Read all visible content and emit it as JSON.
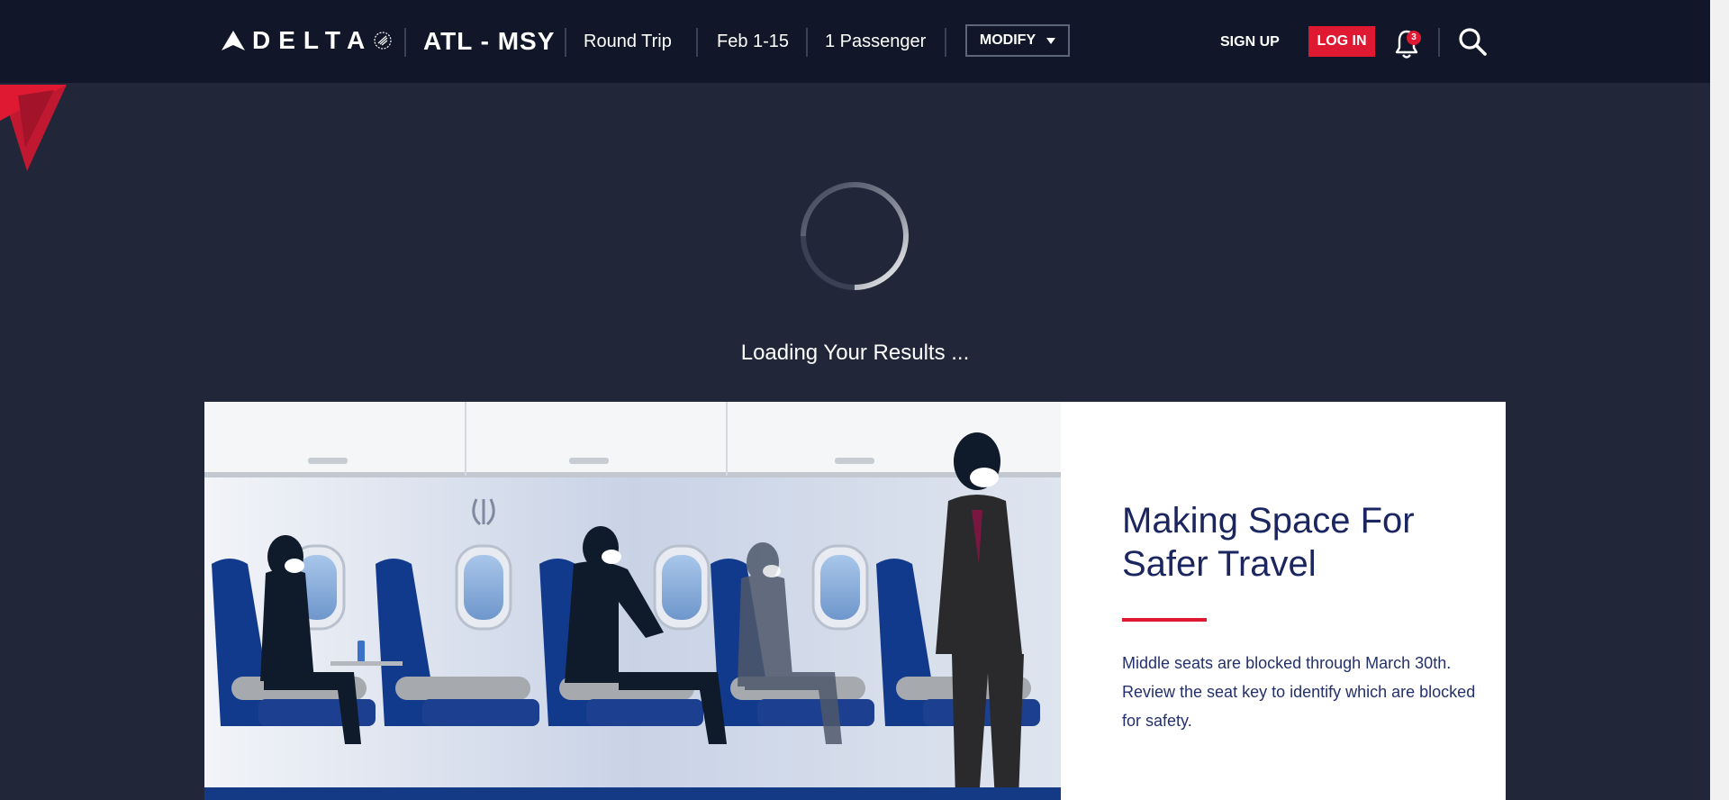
{
  "header": {
    "brand": "DELTA",
    "route": "ATL - MSY",
    "trip_type": "Round Trip",
    "dates": "Feb 1-15",
    "passengers": "1 Passenger",
    "modify_label": "MODIFY",
    "signup_label": "SIGN UP",
    "login_label": "LOG IN",
    "notification_count": "3"
  },
  "loading": {
    "message": "Loading Your Results ..."
  },
  "promo": {
    "title": "Making Space For Safer Travel",
    "body": "Middle seats are blocked through March 30th. Review the seat key to identify which are blocked for safety."
  },
  "icons": {
    "logo": "delta-widget-icon",
    "bell": "bell-icon",
    "search": "search-icon",
    "caret": "chevron-down-icon"
  },
  "colors": {
    "header_bg": "#111728",
    "page_bg": "#212738",
    "accent_red": "#e01933",
    "promo_text": "#1b2660"
  }
}
